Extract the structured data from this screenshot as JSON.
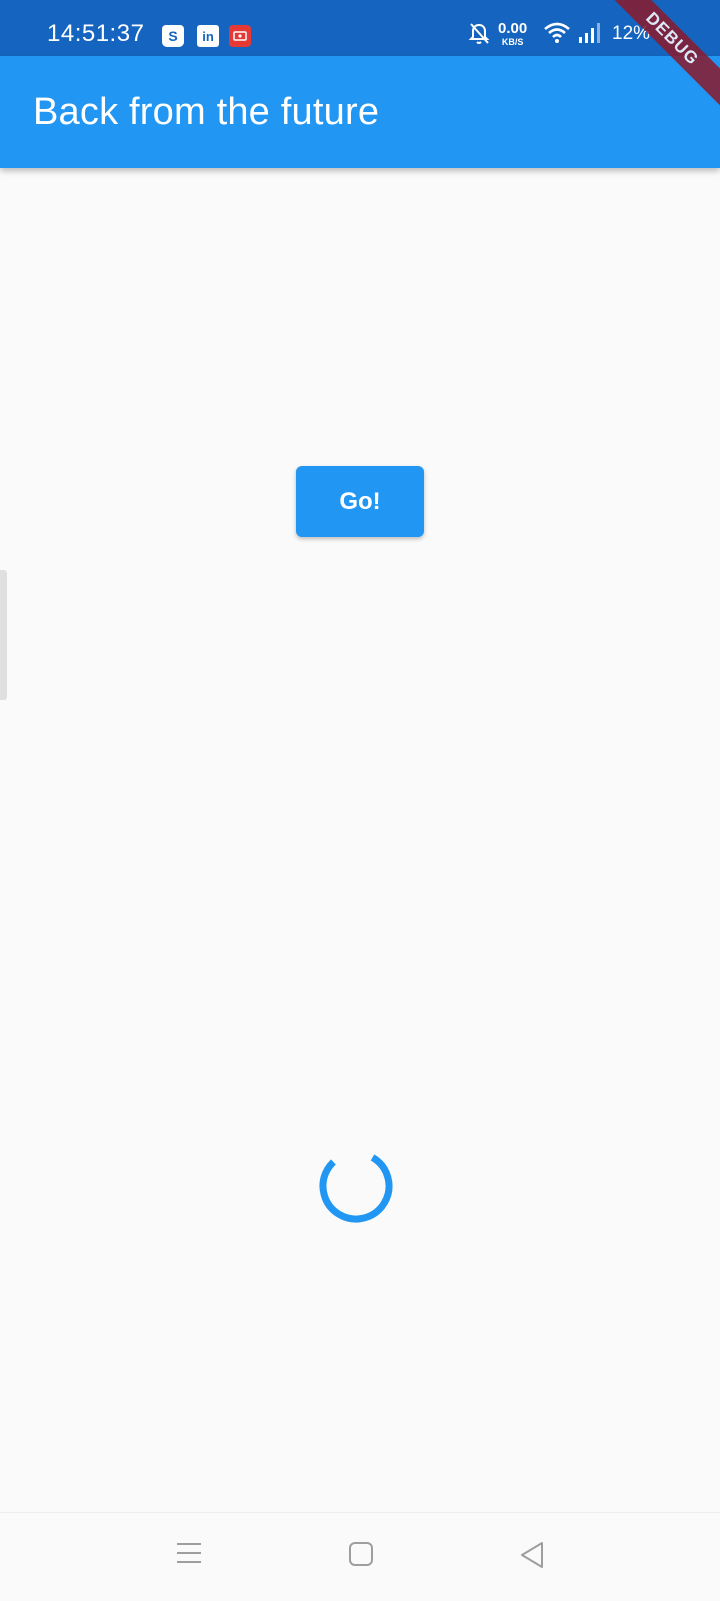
{
  "status_bar": {
    "time": "14:51:37",
    "icons": [
      "shopee-icon",
      "linkedin-icon",
      "screen-record-icon",
      "bell-muted-icon",
      "wifi-icon",
      "signal-icon"
    ],
    "app_icon_labels": {
      "shop": "S",
      "linkedin": "in"
    },
    "net_speed_value": "0.00",
    "net_speed_unit": "KB/S",
    "battery": "12%"
  },
  "app_bar": {
    "title": "Back from the future"
  },
  "debug_banner": "DEBUG",
  "main": {
    "go_button_label": "Go!"
  },
  "colors": {
    "primary": "#2196f3",
    "status_bar": "#1565c0",
    "background": "#fafafa",
    "debug": "#8b1a2b"
  },
  "nav_bar": {
    "buttons": [
      "menu-icon",
      "home-icon",
      "back-icon"
    ]
  }
}
